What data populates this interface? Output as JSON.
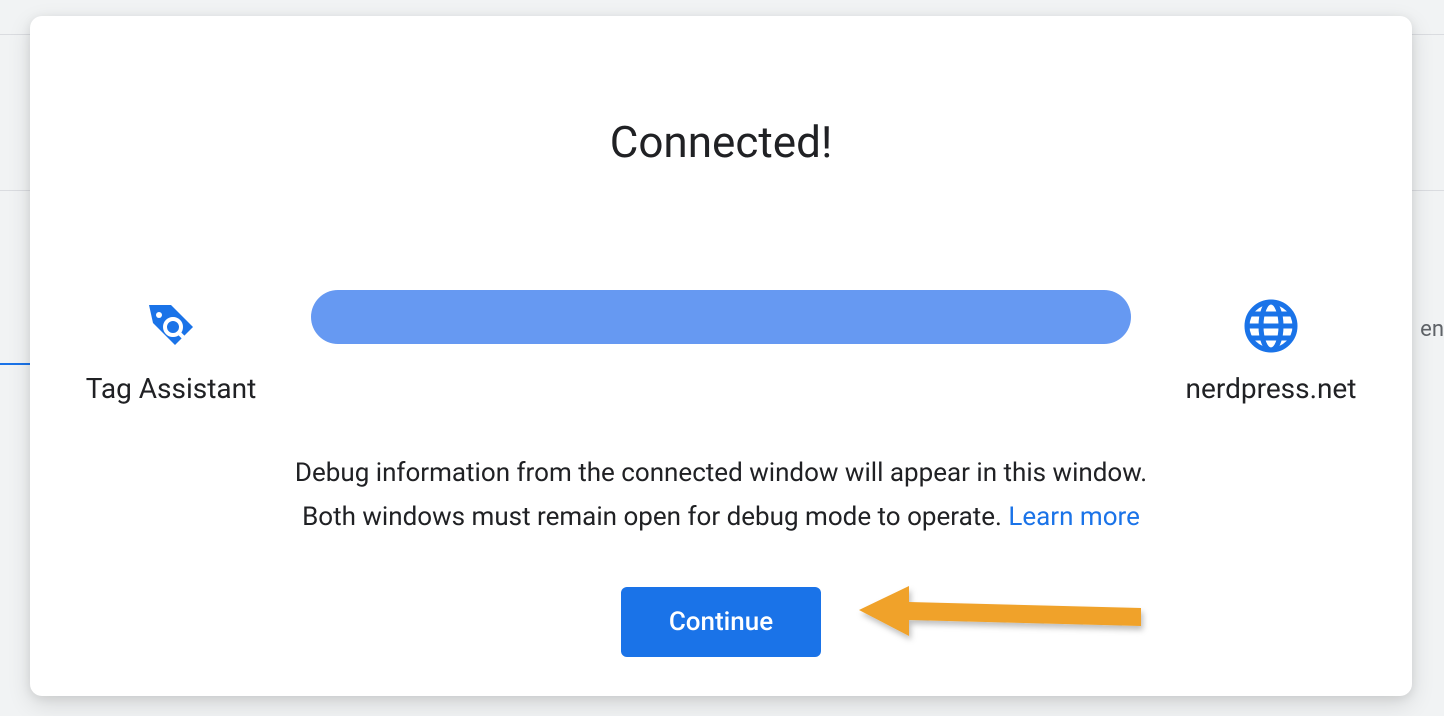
{
  "modal": {
    "title": "Connected!",
    "left_endpoint_label": "Tag Assistant",
    "right_endpoint_label": "nerdpress.net",
    "description_line1": "Debug information from the connected window will appear in this window.",
    "description_line2": "Both windows must remain open for debug mode to operate. ",
    "learn_more": "Learn more",
    "continue_label": "Continue"
  },
  "background": {
    "right_text_fragment": "en"
  },
  "colors": {
    "primary": "#1a73e8",
    "connector": "#6699f2",
    "arrow": "#f0a229"
  }
}
